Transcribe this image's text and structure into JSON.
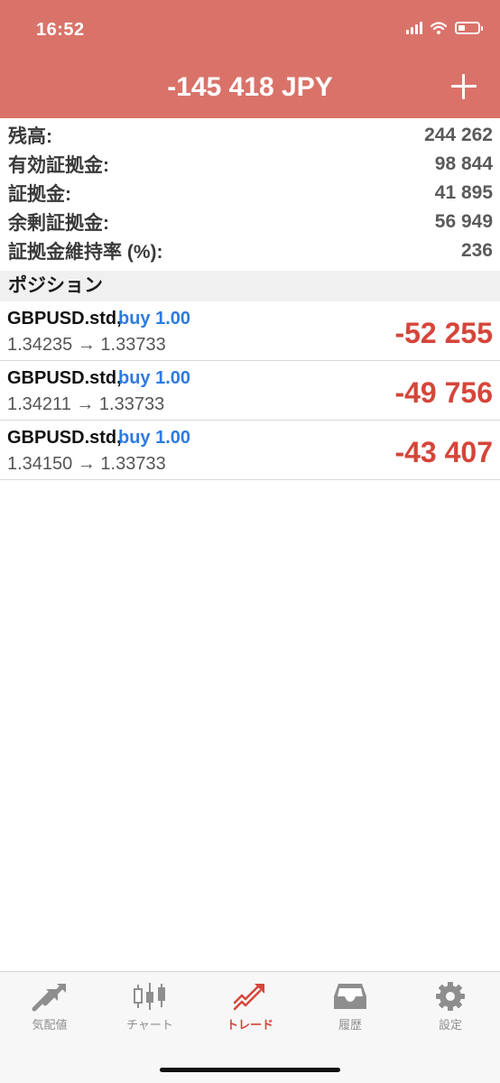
{
  "status_bar": {
    "time": "16:52"
  },
  "header": {
    "title": "-145 418 JPY",
    "add_icon": "plus-icon"
  },
  "summary": {
    "balance_label": "残高:",
    "balance_value": "244 262",
    "equity_label": "有効証拠金:",
    "equity_value": "98 844",
    "margin_label": "証拠金:",
    "margin_value": "41 895",
    "free_margin_label": "余剰証拠金:",
    "free_margin_value": "56 949",
    "margin_level_label": "証拠金維持率 (%):",
    "margin_level_value": "236"
  },
  "positions_section": {
    "title": "ポジション"
  },
  "positions": [
    {
      "symbol": "GBPUSD.std,",
      "type": "buy 1.00",
      "prices": "1.34235 → 1.33733",
      "profit": "-52 255"
    },
    {
      "symbol": "GBPUSD.std,",
      "type": "buy 1.00",
      "prices": "1.34211 → 1.33733",
      "profit": "-49 756"
    },
    {
      "symbol": "GBPUSD.std,",
      "type": "buy 1.00",
      "prices": "1.34150 → 1.33733",
      "profit": "-43 407"
    }
  ],
  "tabs": [
    {
      "label": "気配値",
      "icon": "quotes-arrows-icon"
    },
    {
      "label": "チャート",
      "icon": "candlestick-chart-icon"
    },
    {
      "label": "トレード",
      "icon": "trade-trend-icon",
      "active": true
    },
    {
      "label": "履歴",
      "icon": "history-inbox-icon"
    },
    {
      "label": "設定",
      "icon": "settings-gear-icon"
    }
  ],
  "colors": {
    "header_bg": "#d9736a",
    "buy_blue": "#2d7be0",
    "loss_red": "#d6453a",
    "tab_inactive": "#8e8e8e"
  }
}
